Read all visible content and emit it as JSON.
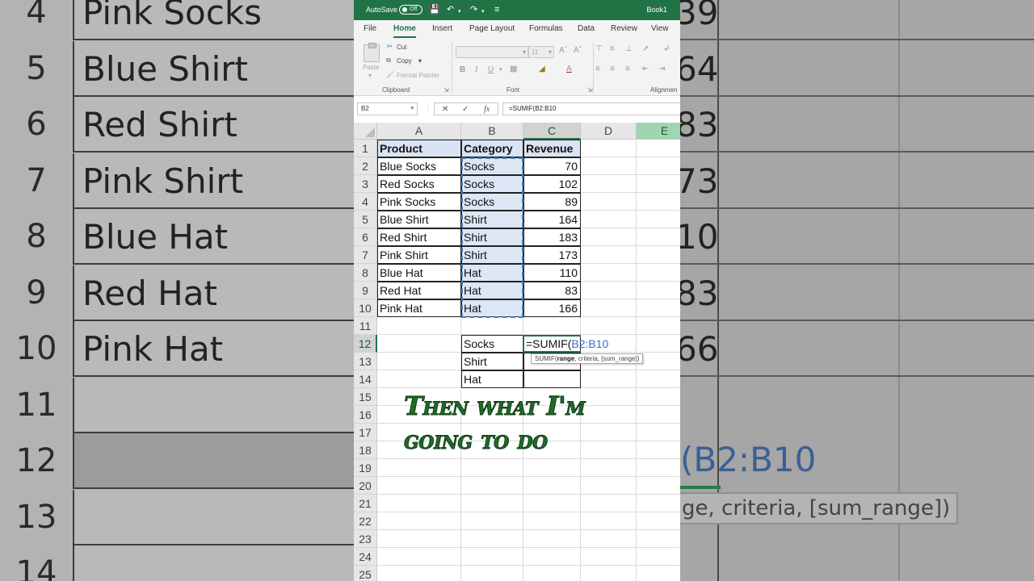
{
  "window": {
    "autosave_label": "AutoSave",
    "autosave_state": "Off",
    "book_title": "Book1"
  },
  "tabs": [
    "File",
    "Home",
    "Insert",
    "Page Layout",
    "Formulas",
    "Data",
    "Review",
    "View"
  ],
  "ribbon": {
    "paste": "Paste",
    "cut": "Cut",
    "copy": "Copy",
    "format_painter": "Format Painter",
    "clipboard_label": "Clipboard",
    "font_label": "Font",
    "font_size": "11",
    "alignment_label": "Alignmen"
  },
  "formula_bar": {
    "name_box": "B2",
    "formula": "=SUMIF(B2:B10"
  },
  "columns": [
    "A",
    "B",
    "C",
    "D",
    "E"
  ],
  "rows": [
    "1",
    "2",
    "3",
    "4",
    "5",
    "6",
    "7",
    "8",
    "9",
    "10",
    "11",
    "12",
    "13",
    "14",
    "15",
    "16",
    "17",
    "18",
    "19",
    "20",
    "21",
    "22",
    "23",
    "24",
    "25"
  ],
  "table": {
    "headers": [
      "Product",
      "Category",
      "Revenue"
    ],
    "products": [
      "Blue Socks",
      "Red Socks",
      "Pink Socks",
      "Blue Shirt",
      "Red Shirt",
      "Pink Shirt",
      "Blue Hat",
      "Red Hat",
      "Pink Hat"
    ],
    "categories": [
      "Socks",
      "Socks",
      "Socks",
      "Shirt",
      "Shirt",
      "Shirt",
      "Hat",
      "Hat",
      "Hat"
    ],
    "revenue": [
      "70",
      "102",
      "89",
      "164",
      "183",
      "173",
      "110",
      "83",
      "166"
    ]
  },
  "summary": {
    "labels": [
      "Socks",
      "Shirt",
      "Hat"
    ],
    "edit_prefix": "=SUMIF(",
    "edit_ref": "B2:B10",
    "tooltip_fn": "SUMIF(",
    "tooltip_bold": "range",
    "tooltip_rest": ", criteria, [sum_range])"
  },
  "caption": {
    "line1": "Then what I'm",
    "line2": "going to do"
  },
  "background": {
    "left_rows": [
      {
        "num": "4",
        "text": "Pink Socks"
      },
      {
        "num": "5",
        "text": "Blue Shirt"
      },
      {
        "num": "6",
        "text": "Red Shirt"
      },
      {
        "num": "7",
        "text": "Pink Shirt"
      },
      {
        "num": "8",
        "text": "Blue Hat"
      },
      {
        "num": "9",
        "text": "Red Hat"
      },
      {
        "num": "10",
        "text": "Pink Hat"
      },
      {
        "num": "11",
        "text": ""
      },
      {
        "num": "12",
        "text": ""
      },
      {
        "num": "13",
        "text": ""
      },
      {
        "num": "14",
        "text": ""
      }
    ],
    "right_values": [
      "39",
      "64",
      "83",
      "73",
      "10",
      "83",
      "66"
    ],
    "right_formula": "(B2:B10",
    "right_tooltip": "ge, criteria, [sum_range])"
  }
}
